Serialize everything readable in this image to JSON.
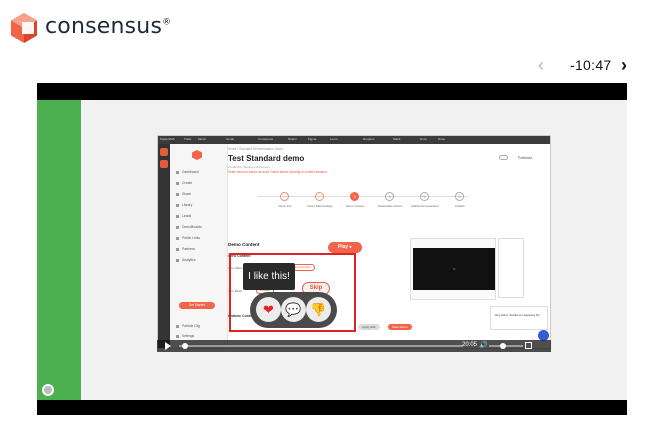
{
  "brand": {
    "name": "consensus",
    "mark": "®",
    "accent": "#e85a3c"
  },
  "nav": {
    "time_remaining": "-10:47",
    "prev_icon": "chevron-left-icon",
    "next_icon": "chevron-right-icon"
  },
  "app": {
    "topbar": [
      "Kayla MVA",
      "Trello",
      "Mural",
      "Gmail",
      "Consensus",
      "Notion",
      "Figma",
      "Loom",
      "Dropbox",
      "Slack",
      "Docs",
      "Drive"
    ],
    "sidebar": [
      {
        "label": "Dashboard"
      },
      {
        "label": "Create"
      },
      {
        "label": "Share"
      },
      {
        "label": "Library"
      },
      {
        "label": "Leads"
      },
      {
        "label": "DemoBoards"
      },
      {
        "label": "Public Links"
      },
      {
        "label": "Partners"
      },
      {
        "label": "Analytics"
      }
    ],
    "sidebar_button": "Get Started",
    "sidebar_footer": [
      "Particle Org",
      "Settings"
    ],
    "breadcrumb": "Home / Standard Demonstration Demo",
    "title": "Test Standard demo",
    "subtitle": "Created by Stephen Mortensen",
    "warning": "Draft: demo is saved as draft. Demo before sharing in content session.",
    "published_label": "Published",
    "steps": [
      {
        "num": "✓",
        "label": "Demo Info",
        "state": "done"
      },
      {
        "num": "✓",
        "label": "Demo Data Settings",
        "state": "done"
      },
      {
        "num": "3",
        "label": "Demo Content",
        "state": "active"
      },
      {
        "num": "4",
        "label": "Stakeholder Actions",
        "state": "todo"
      },
      {
        "num": "5",
        "label": "Additional Interactions",
        "state": "todo"
      },
      {
        "num": "6",
        "label": "Finalize",
        "state": "todo"
      }
    ],
    "demo_content_title": "Demo Content",
    "play_label": "Play ▸",
    "intro_content": "Intro Content",
    "intro_video_label": "Intro Video",
    "upload_label": "Upload",
    "record_label": "Record Now",
    "upload_youtube_label": "Upload From Youtube",
    "intro_deck_label": "Intro Deck",
    "deck_upload_label": "Upload",
    "feature_content": "Feature Content",
    "add_feature_label": "Add Feature",
    "apply_label": "Apply Edit",
    "save_label": "Save Demo",
    "chat_text": "Hey there, thanks for stopping by!",
    "preview_label": "TA"
  },
  "player": {
    "time": "20:05",
    "progress": 0.02,
    "volume": 0.4
  },
  "feedback": {
    "tooltip": "I like this!",
    "skip_label": "Skip",
    "reactions": [
      {
        "icon": "heart-icon",
        "glyph": "❤"
      },
      {
        "icon": "chat-bubble-icon",
        "glyph": "💬"
      },
      {
        "icon": "thumbs-down-icon",
        "glyph": "👎"
      }
    ]
  }
}
